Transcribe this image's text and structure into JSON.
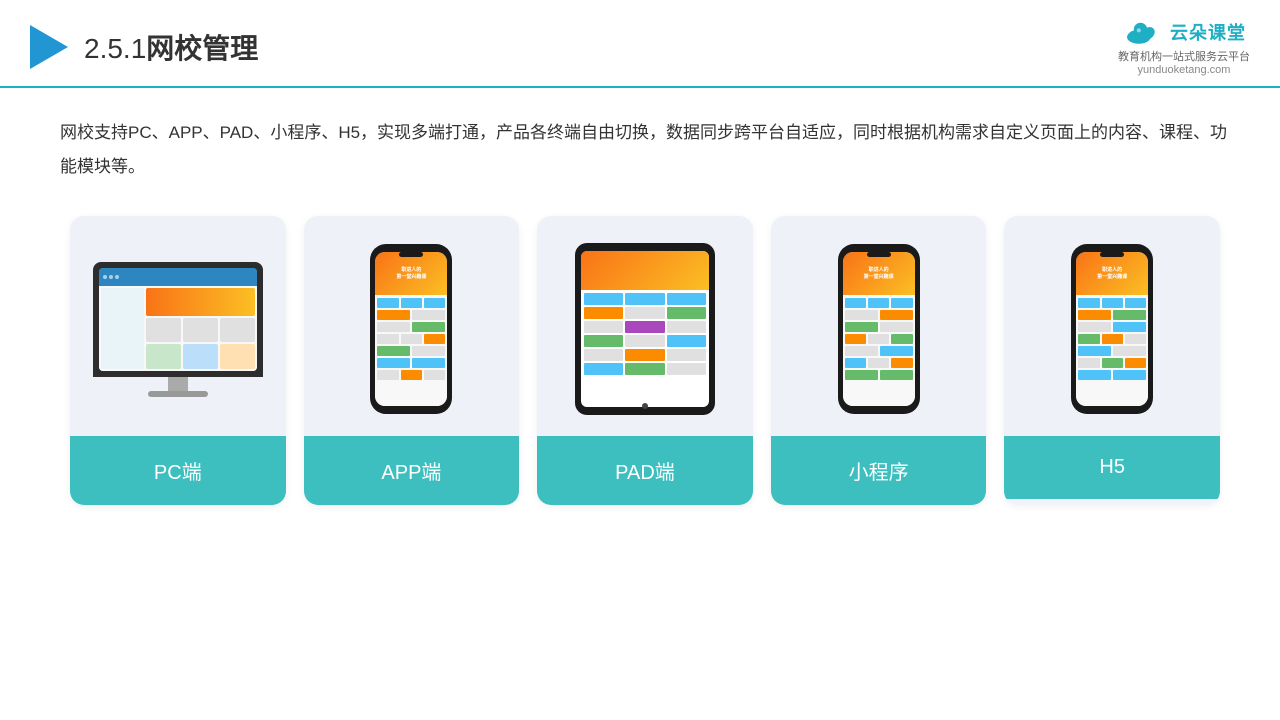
{
  "header": {
    "section_number": "2.5.1",
    "title": "网校管理",
    "logo_name": "云朵课堂",
    "logo_url": "yunduoketang.com",
    "logo_tagline": "教育机构一站\n式服务云平台"
  },
  "description": {
    "text": "网校支持PC、APP、PAD、小程序、H5，实现多端打通，产品各终端自由切换，数据同步跨平台自适应，同时根据机构需求自定义页面上的内容、课程、功能模块等。"
  },
  "cards": [
    {
      "id": "pc",
      "label": "PC端"
    },
    {
      "id": "app",
      "label": "APP端"
    },
    {
      "id": "pad",
      "label": "PAD端"
    },
    {
      "id": "miniapp",
      "label": "小程序"
    },
    {
      "id": "h5",
      "label": "H5"
    }
  ],
  "colors": {
    "accent": "#1EAFC4",
    "card_bg": "#eef2f8",
    "card_label_bg": "#3DBFBF",
    "header_border": "#1EAFC4",
    "title_color": "#333"
  }
}
